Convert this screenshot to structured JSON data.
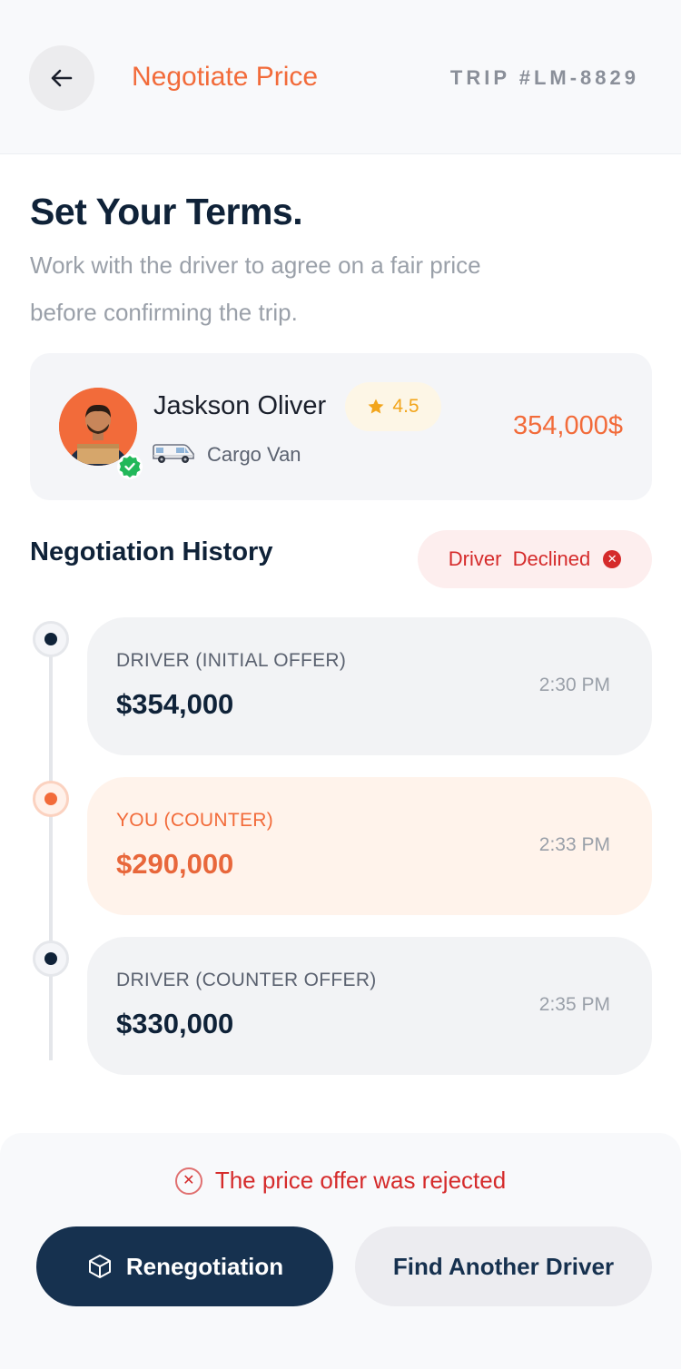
{
  "header": {
    "title": "Negotiate Price",
    "trip_id": "TRIP #LM-8829",
    "back_icon": "arrow-left-icon"
  },
  "intro": {
    "heading": "Set Your Terms.",
    "line1": "Work with the driver to agree on a fair price",
    "line2": "before confirming the trip."
  },
  "driver": {
    "name": "Jaskson Oliver",
    "rating": "4.5",
    "vehicle": "Cargo Van",
    "price": "354,000$",
    "verified_icon": "verified-badge-icon"
  },
  "history": {
    "title": "Negotiation History",
    "status": "Driver  Declined",
    "status_color": "#d52b2b",
    "offers": [
      {
        "who": "DRIVER (INITIAL OFFER)",
        "amount": "$354,000",
        "time": "2:30 PM"
      },
      {
        "who": "YOU (COUNTER)",
        "amount": "$290,000",
        "time": "2:33 PM"
      },
      {
        "who": "DRIVER (COUNTER OFFER)",
        "amount": "$330,000",
        "time": "2:35 PM"
      }
    ]
  },
  "footer": {
    "message": "The price offer was rejected",
    "primary_label": "Renegotiation",
    "secondary_label": "Find Another Driver"
  },
  "colors": {
    "accent": "#f26b3a",
    "navy": "#16314f",
    "danger": "#d52b2b"
  }
}
